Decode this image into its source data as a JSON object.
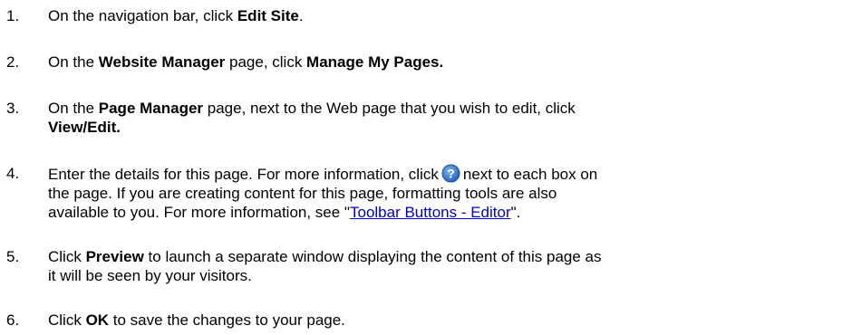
{
  "steps": [
    {
      "number": "1.",
      "t1": "On the navigation bar, click ",
      "b1": "Edit Site",
      "t2": "."
    },
    {
      "number": "2.",
      "t1": "On the ",
      "b1": "Website Manager",
      "t2": " page, click ",
      "b2": "Manage My Pages."
    },
    {
      "number": "3.",
      "t1": "On the ",
      "b1": "Page Manager",
      "t2": " page, next to the Web page that you wish to edit, click",
      "b2": "View/Edit."
    },
    {
      "number": "4.",
      "t1": "Enter the details for this page. For more information, click",
      "icon": "help-question-icon",
      "t2": "next to each box on",
      "l2": "the page.  If you are creating content for this page, formatting tools are also",
      "t3": "available to you. For more information, see \"",
      "link": "Toolbar Buttons - Editor",
      "t4": "\"."
    },
    {
      "number": "5.",
      "t1": "Click ",
      "b1": "Preview",
      "t2": " to launch a separate window displaying the content of this page as",
      "l2": "it will be seen by your visitors."
    },
    {
      "number": "6.",
      "t1": "Click ",
      "b1": "OK",
      "t2": " to save the changes to your page."
    }
  ],
  "colors": {
    "link": "#0000cc",
    "icon_fill": "#2c6fc9",
    "text": "#000000"
  }
}
